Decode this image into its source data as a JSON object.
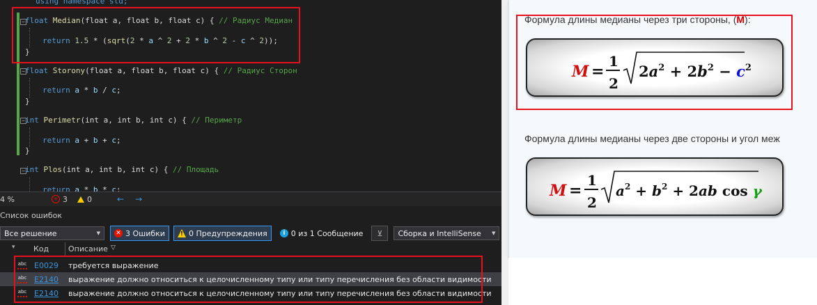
{
  "editor": {
    "lines": {
      "using": "using namespace std;",
      "median_sig": {
        "kw": "float",
        "name": "Median",
        "params": "(float a, float b, float c) {",
        "comment": "// Радиус Медиан"
      },
      "median_ret": "return 1.5 * (sqrt(2 * a ^ 2 + 2 * b ^ 2 - c ^ 2));",
      "storony_sig": {
        "kw": "float",
        "name": "Storony",
        "params": "(float a, float b, float c) {",
        "comment": "// Радиус Сторон"
      },
      "storony_ret": "return a * b / c;",
      "perimetr_sig": {
        "kw": "int",
        "name": "Perimetr",
        "params": "(int a, int b, int c) {",
        "comment": "// Периметр"
      },
      "perimetr_ret": "return a + b + c;",
      "plos_sig": {
        "kw": "int",
        "name": "Plos",
        "params": "(int a, int b, int c) {",
        "comment": "// Площадь"
      },
      "plos_ret": "return a * b * c;"
    }
  },
  "statusbar": {
    "zoom": "4 %",
    "errors": "3",
    "warnings": "0"
  },
  "error_list": {
    "title": "Список ошибок",
    "scope": "Все решение",
    "errors_btn": "3 Ошибки",
    "warnings_btn": "0 Предупреждения",
    "messages_btn": "0 из 1 Сообщение",
    "build_combo": "Сборка и IntelliSense",
    "col_code": "Код",
    "col_desc": "Описание",
    "rows": [
      {
        "code": "E0029",
        "desc": "требуется выражение"
      },
      {
        "code": "E2140",
        "desc": "выражение должно относиться к целочисленному типу или типу перечисления без области видимости"
      },
      {
        "code": "E2140",
        "desc": "выражение должно относиться к целочисленному типу или типу перечисления без области видимости"
      }
    ]
  },
  "web": {
    "formula1_caption_pre": "Формула длины медианы через три стороны, (",
    "formula1_caption_m": "M",
    "formula1_caption_post": "):",
    "formula2_caption": "Формула длины медианы через две стороны и угол меж",
    "formula1": {
      "lhs": "M",
      "eq": "=",
      "num": "1",
      "den": "2",
      "radicand": "2a² + 2b² − c²"
    },
    "formula2": {
      "lhs": "M",
      "eq": "=",
      "num": "1",
      "den": "2",
      "radicand": "a² + b² + 2ab cos γ"
    }
  },
  "colors": {
    "highlight_red": "#e8101a",
    "editor_bg": "#1e1e1e",
    "link_blue": "#3a96dd"
  }
}
